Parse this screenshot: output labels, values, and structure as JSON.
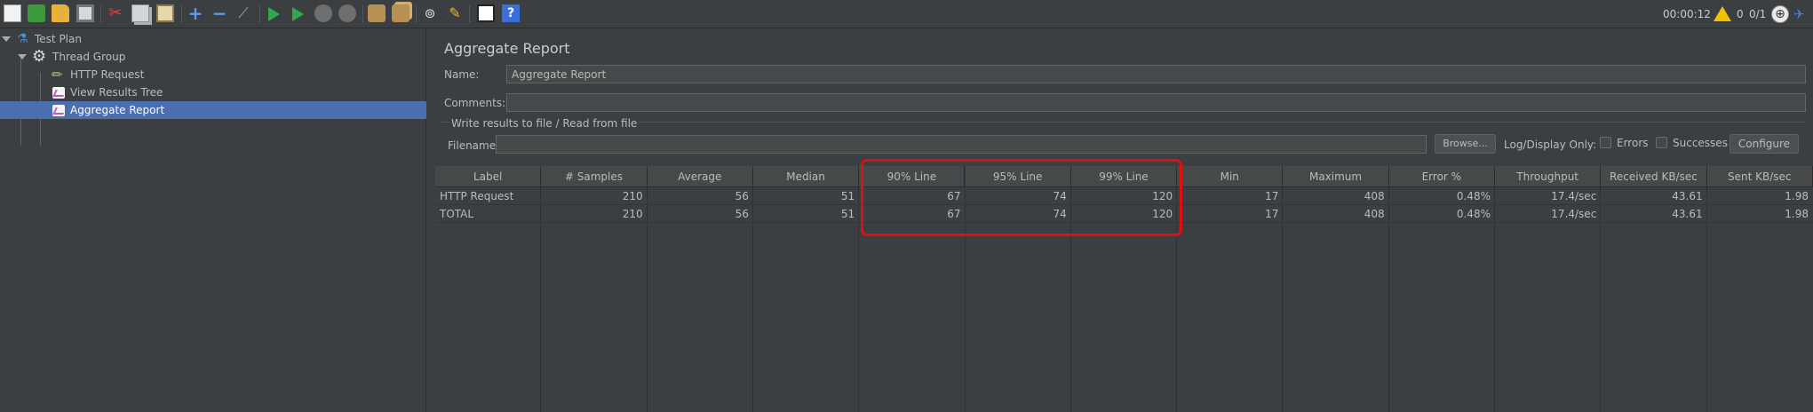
{
  "toolbar": {
    "icons": [
      "new-icon",
      "templates-icon",
      "open-icon",
      "save-icon",
      "cut-icon",
      "copy-icon",
      "paste-icon",
      "expand-icon",
      "collapse-icon",
      "toggle-icon",
      "start-icon",
      "start-no-pause-icon",
      "stop-icon",
      "shutdown-icon",
      "clear-icon",
      "clear-all-icon",
      "search-icon",
      "reset-search-icon",
      "function-helper-icon",
      "help-icon"
    ],
    "timer": "00:00:12",
    "warning_count": "0",
    "threads": "0/1"
  },
  "tree": {
    "items": [
      {
        "label": "Test Plan",
        "icon": "test-plan-icon"
      },
      {
        "label": "Thread Group",
        "icon": "gear-icon"
      },
      {
        "label": "HTTP Request",
        "icon": "sampler-icon"
      },
      {
        "label": "View Results Tree",
        "icon": "listener-icon"
      },
      {
        "label": "Aggregate Report",
        "icon": "listener-icon",
        "selected": true
      }
    ]
  },
  "main": {
    "title": "Aggregate Report",
    "name_label": "Name:",
    "name_value": "Aggregate Report",
    "comments_label": "Comments:",
    "comments_value": "",
    "file_group_title": "Write results to file / Read from file",
    "filename_label": "Filename",
    "filename_value": "",
    "browse_label": "Browse...",
    "log_display_label": "Log/Display Only:",
    "errors_label": "Errors",
    "successes_label": "Successes",
    "configure_label": "Configure"
  },
  "table": {
    "columns": [
      "Label",
      "# Samples",
      "Average",
      "Median",
      "90% Line",
      "95% Line",
      "99% Line",
      "Min",
      "Maximum",
      "Error %",
      "Throughput",
      "Received KB/sec",
      "Sent KB/sec"
    ],
    "rows": [
      [
        "HTTP Request",
        "210",
        "56",
        "51",
        "67",
        "74",
        "120",
        "17",
        "408",
        "0.48%",
        "17.4/sec",
        "43.61",
        "1.98"
      ],
      [
        "TOTAL",
        "210",
        "56",
        "51",
        "67",
        "74",
        "120",
        "17",
        "408",
        "0.48%",
        "17.4/sec",
        "43.61",
        "1.98"
      ]
    ]
  },
  "colors": {
    "background": "#3c3f41",
    "selection": "#4b6eaf",
    "highlight_box": "#e01010"
  }
}
